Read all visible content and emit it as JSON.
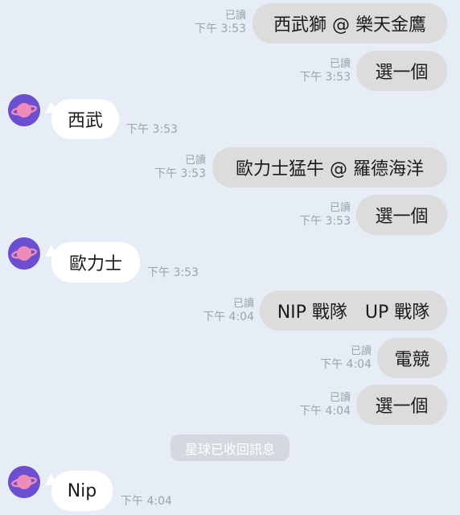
{
  "messages": [
    {
      "side": "sent",
      "text": "西武獅 @ 樂天金鷹",
      "read": "已讀",
      "time": "下午 3:53"
    },
    {
      "side": "sent",
      "text": "選一個",
      "read": "已讀",
      "time": "下午 3:53"
    },
    {
      "side": "recv",
      "text": "西武",
      "time": "下午 3:53"
    },
    {
      "side": "sent",
      "text": "歐力士猛牛 @ 羅德海洋",
      "read": "已讀",
      "time": "下午 3:53"
    },
    {
      "side": "sent",
      "text": "選一個",
      "read": "已讀",
      "time": "下午 3:53"
    },
    {
      "side": "recv",
      "text": "歐力士",
      "time": "下午 3:53"
    },
    {
      "side": "sent",
      "text": "NIP 戰隊　UP 戰隊",
      "read": "已讀",
      "time": "下午 4:04"
    },
    {
      "side": "sent",
      "text": "電競",
      "read": "已讀",
      "time": "下午 4:04"
    },
    {
      "side": "sent",
      "text": "選一個",
      "read": "已讀",
      "time": "下午 4:04"
    },
    {
      "side": "recv",
      "text": "Nip",
      "time": "下午 4:04"
    }
  ],
  "system_notice": "星球已收回訊息",
  "colors": {
    "background": "#e7edf6",
    "sent_bubble": "#dcdcdc",
    "recv_bubble": "#ffffff",
    "avatar": "#6b4fd0",
    "meta": "#9ba3ad"
  },
  "icons": {
    "avatar": "planet-avatar-icon"
  }
}
